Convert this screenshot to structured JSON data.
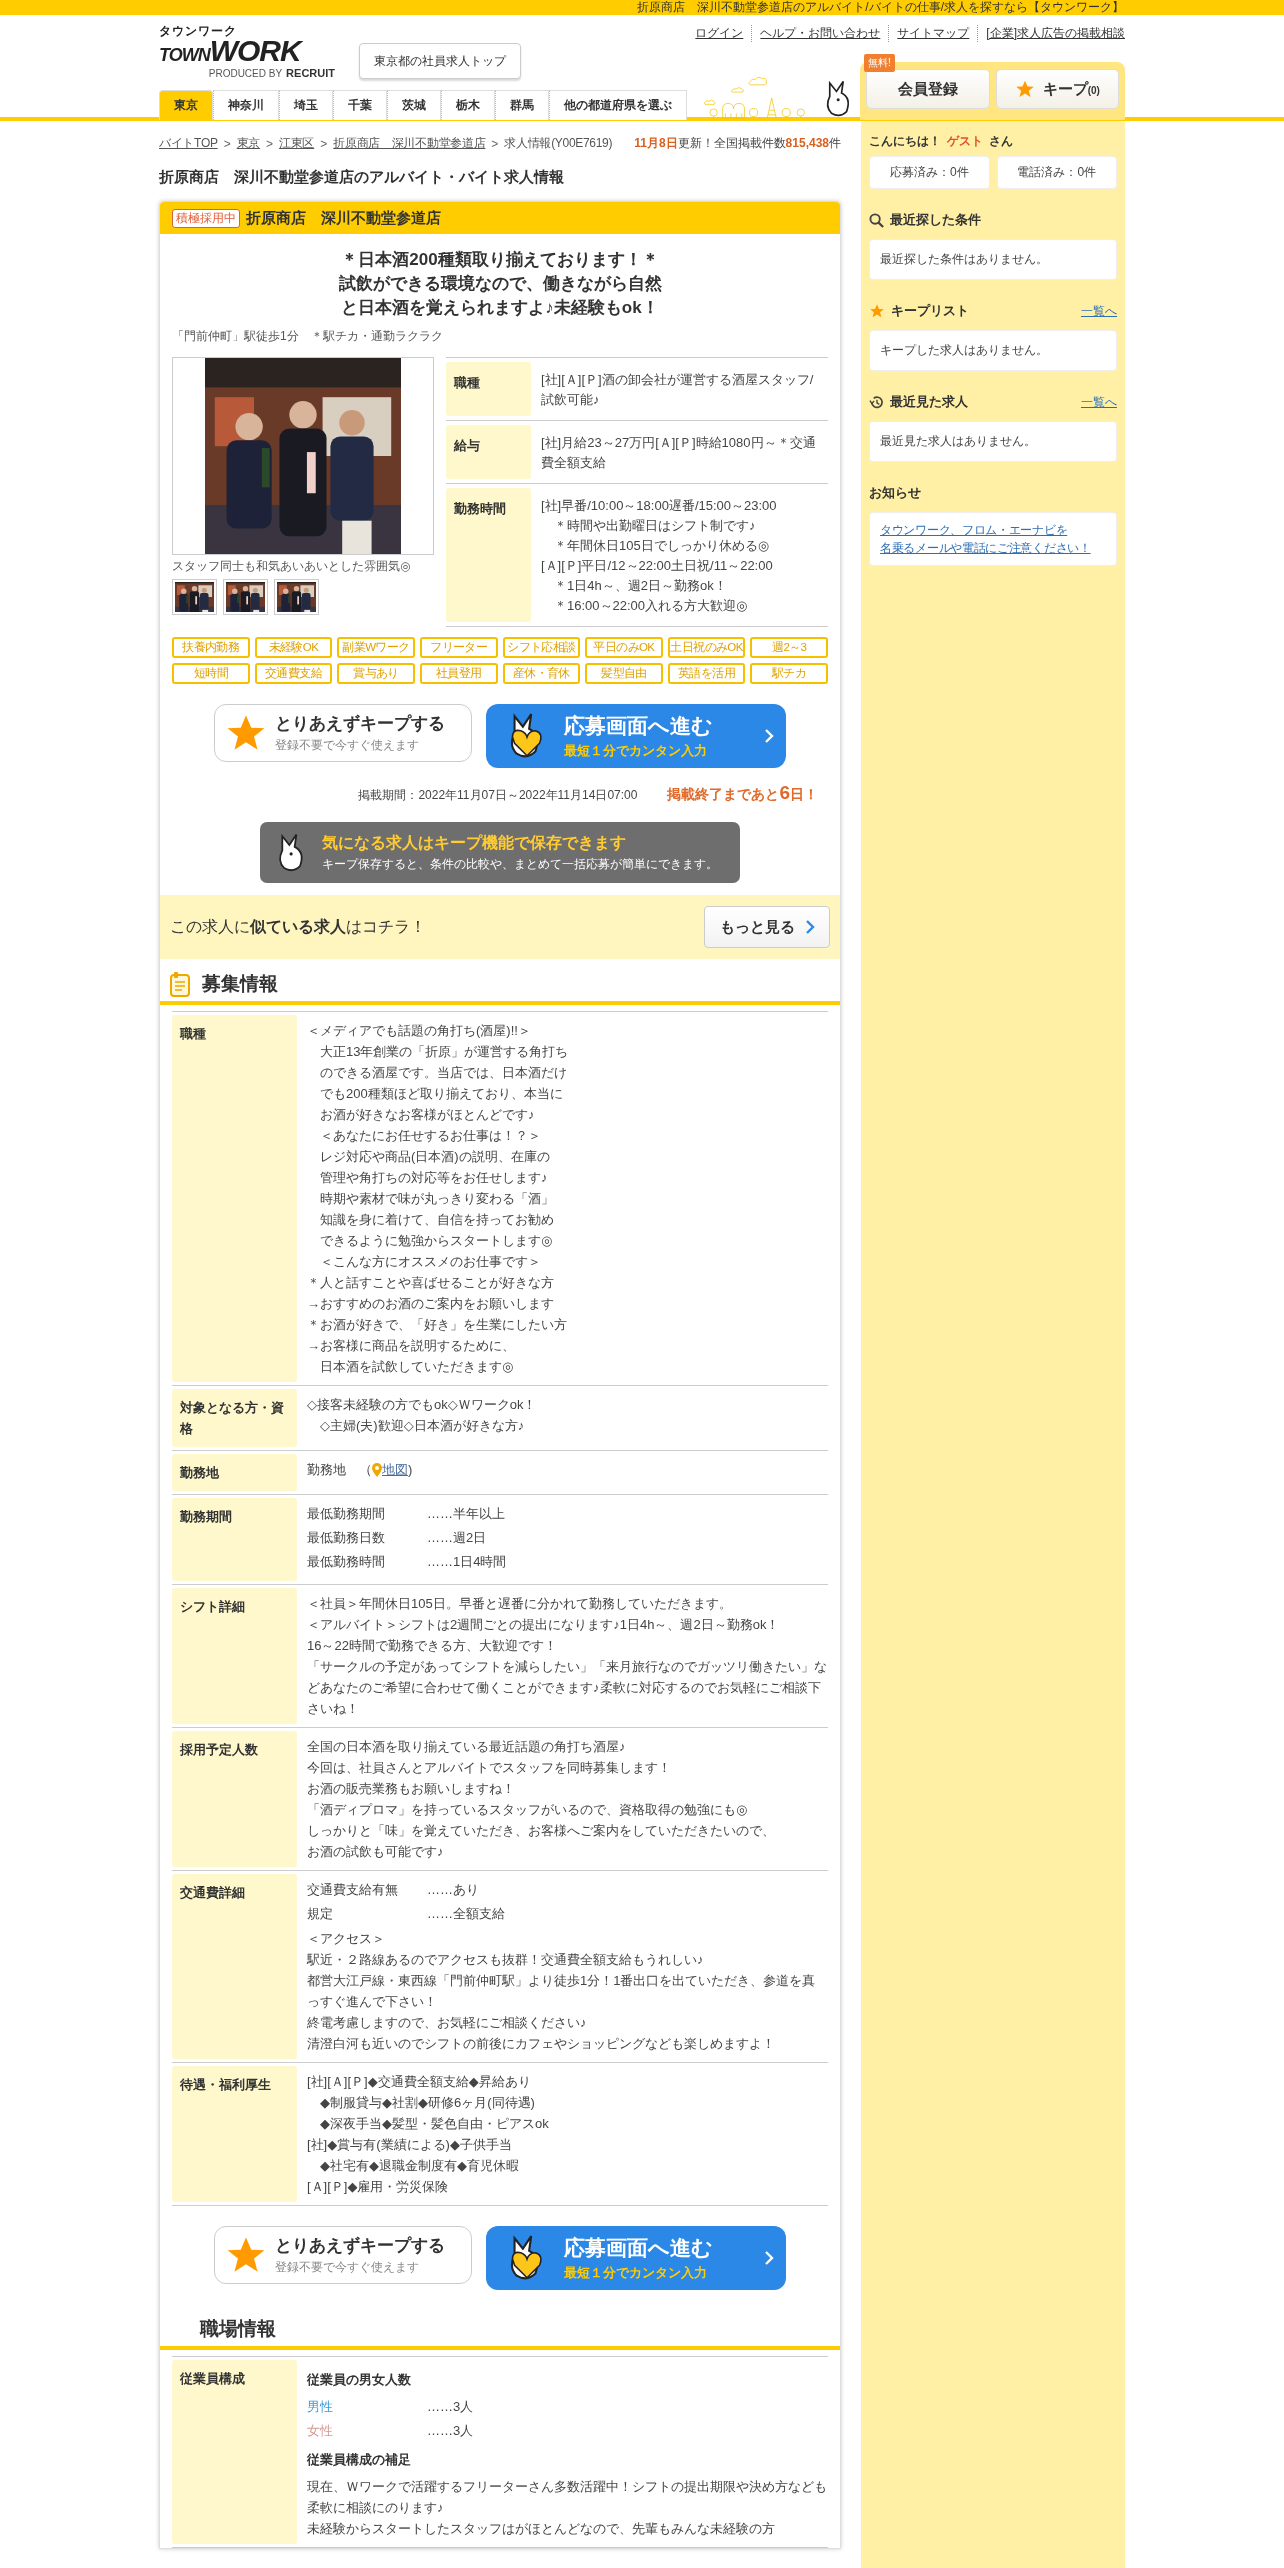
{
  "top_bar": {
    "text": "折原商店　深川不動堂参道店のアルバイト/バイトの仕事/求人を探すなら【タウンワーク】"
  },
  "header": {
    "logo": {
      "kana": "タウンワーク",
      "word_1": "TOWN",
      "word_2": "WORK",
      "credit": "PRODUCED BY",
      "brand": "RECRUIT"
    },
    "top_button": "東京都の社員求人トップ",
    "links": [
      "ログイン",
      "ヘルプ・お問い合わせ",
      "サイトマップ",
      "[企業]求人広告の掲載相談"
    ],
    "register": {
      "badge": "無料!",
      "label": "会員登録"
    },
    "keep": {
      "label": "キープ",
      "count": "(0)"
    },
    "prefecture_tabs": [
      {
        "label": "東京",
        "selected": true
      },
      {
        "label": "神奈川",
        "selected": false
      },
      {
        "label": "埼玉",
        "selected": false
      },
      {
        "label": "千葉",
        "selected": false
      },
      {
        "label": "茨城",
        "selected": false
      },
      {
        "label": "栃木",
        "selected": false
      },
      {
        "label": "群馬",
        "selected": false
      },
      {
        "label": "他の都道府県を選ぶ",
        "selected": false
      }
    ]
  },
  "breadcrumb": [
    {
      "label": "バイトTOP",
      "link": true
    },
    {
      "label": "東京",
      "link": true,
      "prefix": ">"
    },
    {
      "label": "江東区",
      "link": true,
      "prefix": ">"
    },
    {
      "label": "折原商店　深川不動堂参道店",
      "link": true,
      "prefix": ">"
    },
    {
      "label": "求人情報(Y00E7619)",
      "link": false,
      "prefix": ">"
    }
  ],
  "update": {
    "date": "11月8日",
    "text": "更新！全国掲載件数",
    "count": "815,438",
    "unit": "件"
  },
  "page_title": "折原商店　深川不動堂参道店のアルバイト・バイト求人情報",
  "job": {
    "badge": "積極採用中",
    "store": "折原商店　深川不動堂参道店",
    "catch": [
      "＊日本酒200種類取り揃えております！＊",
      "試飲ができる環境なので、働きながら自然",
      "と日本酒を覚えられますよ♪未経験もok！"
    ],
    "access": "「門前仲町」駅徒歩1分　＊駅チカ・通勤ラクラク",
    "photo": {
      "kind": "picture"
    },
    "photo_caption": "スタッフ同士も和気あいあいとした雰囲気◎",
    "thumbnails": [
      {
        "kind": "picture"
      },
      {
        "kind": "picture"
      },
      {
        "kind": "picture"
      }
    ],
    "summary": [
      {
        "label": "職種",
        "lines": [
          "[社][Ａ][Ｐ]酒の卸会社が運営する酒屋スタッフ/試飲可能♪"
        ]
      },
      {
        "label": "給与",
        "lines": [
          "[社]月給23～27万円[Ａ][Ｐ]時給1080円～＊交通費全額支給"
        ]
      },
      {
        "label": "勤務時間",
        "lines": [
          "[社]早番/10:00～18:00遅番/15:00～23:00",
          "　＊時間や出勤曜日はシフト制です♪",
          "　＊年間休日105日でしっかり休める◎",
          "[Ａ][Ｐ]平日/12～22:00土日祝/11～22:00",
          "　＊1日4h～、週2日～勤務ok！",
          "　＊16:00～22:00入れる方大歓迎◎"
        ]
      }
    ],
    "tags": [
      "扶養内勤務",
      "未経験OK",
      "副業Wワーク",
      "フリーター",
      "シフト応相談",
      "平日のみOK",
      "土日祝のみOK",
      "週2～3",
      "短時間",
      "交通費支給",
      "賞与あり",
      "社員登用",
      "産休・育休",
      "髪型自由",
      "英語を活用",
      "駅チカ"
    ]
  },
  "actions_top": {
    "keep_title": "とりあえずキープする",
    "keep_sub": "登録不要で今すぐ使えます",
    "apply_title": "応募画面へ進む",
    "apply_sub": "最短１分でカンタン入力"
  },
  "period": {
    "text": "掲載期間：2022年11月07日～2022年11月14日07:00",
    "before": "掲載終了まであと",
    "days": "6",
    "after": "日！"
  },
  "keep_banner": {
    "title": "気になる求人はキープ機能で保存できます",
    "text": "キープ保存すると、条件の比較や、まとめて一括応募が簡単にできます。"
  },
  "similar": {
    "text": "この求人に**似ている求人**はコチラ！",
    "button": "もっと見る"
  },
  "recruit_section": {
    "title": "募集情報",
    "rows": [
      {
        "label": "職種",
        "blocks": [
          {
            "kind": "lines",
            "lines": [
              "＜メディアでも話題の角打ち(酒屋)!!＞",
              "　大正13年創業の「折原」が運営する角打ち",
              "　のできる酒屋です。当店では、日本酒だけ",
              "　でも200種類ほど取り揃えており、本当に",
              "　お酒が好きなお客様がほとんどです♪",
              "　＜あなたにお任せするお仕事は！？＞",
              "　レジ対応や商品(日本酒)の説明、在庫の",
              "　管理や角打ちの対応等をお任せします♪",
              "　時期や素材で味が丸っきり変わる「酒」",
              "　知識を身に着けて、自信を持ってお勧め",
              "　できるように勉強からスタートします◎",
              "　＜こんな方にオススメのお仕事です＞",
              "＊人と話すことや喜ばせることが好きな方",
              "→おすすめのお酒のご案内をお願いします",
              "＊お酒が好きで、「好き」を生業にしたい方",
              "→お客様に商品を説明するために、",
              "　日本酒を試飲していただきます◎"
            ]
          }
        ]
      },
      {
        "label": "対象となる方・資格",
        "blocks": [
          {
            "kind": "lines",
            "lines": [
              "◇接客未経験の方でもok◇Ｗワークok！",
              "　◇主婦(夫)歓迎◇日本酒が好きな方♪"
            ]
          }
        ]
      },
      {
        "label": "勤務地",
        "blocks": [
          {
            "kind": "location",
            "before": "勤務地　（",
            "link": "地図",
            "after": ")"
          }
        ]
      },
      {
        "label": "勤務期間",
        "blocks": [
          {
            "kind": "pairs",
            "items": [
              {
                "label": "最低勤務期間",
                "value": "……半年以上"
              },
              {
                "label": "最低勤務日数",
                "value": "……週2日"
              },
              {
                "label": "最低勤務時間",
                "value": "……1日4時間"
              }
            ]
          }
        ]
      },
      {
        "label": "シフト詳細",
        "blocks": [
          {
            "kind": "lines",
            "lines": [
              "＜社員＞年間休日105日。早番と遅番に分かれて勤務していただきます。",
              "＜アルバイト＞シフトは2週間ごとの提出になります♪1日4h～、週2日～勤務ok！",
              "16～22時間で勤務できる方、大歓迎です！",
              "「サークルの予定があってシフトを減らしたい」「来月旅行なのでガッツリ働きたい」などあなたのご希望に合わせて働くことができます♪柔軟に対応するのでお気軽にご相談下さいね！"
            ]
          }
        ]
      },
      {
        "label": "採用予定人数",
        "blocks": [
          {
            "kind": "lines",
            "lines": [
              "全国の日本酒を取り揃えている最近話題の角打ち酒屋♪",
              "今回は、社員さんとアルバイトでスタッフを同時募集します！",
              "お酒の販売業務もお願いしますね！",
              "「酒ディプロマ」を持っているスタッフがいるので、資格取得の勉強にも◎",
              "しっかりと「味」を覚えていただき、お客様へご案内をしていただきたいので、",
              "お酒の試飲も可能です♪"
            ]
          }
        ]
      },
      {
        "label": "交通費詳細",
        "blocks": [
          {
            "kind": "pairs",
            "items": [
              {
                "label": "交通費支給有無",
                "value": "……あり"
              },
              {
                "label": "規定",
                "value": "……全額支給"
              }
            ]
          },
          {
            "kind": "lines",
            "lines": [
              "＜アクセス＞",
              "駅近・２路線あるのでアクセスも抜群！交通費全額支給もうれしい♪",
              "都営大江戸線・東西線「門前仲町駅」より徒歩1分！1番出口を出ていただき、参道を真っすぐ進んで下さい！",
              "終電考慮しますので、お気軽にご相談ください♪",
              "清澄白河も近いのでシフトの前後にカフェやショッピングなども楽しめますよ！"
            ]
          }
        ]
      },
      {
        "label": "待遇・福利厚生",
        "blocks": [
          {
            "kind": "lines",
            "lines": [
              "[社][Ａ][Ｐ]◆交通費全額支給◆昇給あり",
              "　◆制服貸与◆社割◆研修6ヶ月(同待遇)",
              "　◆深夜手当◆髪型・髪色自由・ピアスok",
              "[社]◆賞与有(業績による)◆子供手当",
              "　◆社宅有◆退職金制度有◆育児休暇",
              "[Ａ][Ｐ]◆雇用・労災保険"
            ]
          }
        ]
      }
    ]
  },
  "actions_bottom": {
    "keep_title": "とりあえずキープする",
    "keep_sub": "登録不要で今すぐ使えます",
    "apply_title": "応募画面へ進む",
    "apply_sub": "最短１分でカンタン入力"
  },
  "workplace_section": {
    "title": "職場情報",
    "rows": [
      {
        "label": "従業員構成",
        "blocks": [
          {
            "kind": "heading",
            "text": "従業員の男女人数"
          },
          {
            "kind": "pairs",
            "items": [
              {
                "label": "男性",
                "value": "……3人",
                "color": "#3a9ad9"
              },
              {
                "label": "女性",
                "value": "……3人",
                "color": "#d49a94"
              }
            ]
          },
          {
            "kind": "heading",
            "text": "従業員構成の補足"
          },
          {
            "kind": "lines",
            "lines": [
              "現在、Ｗワークで活躍するフリーターさん多数活躍中！シフトの提出期限や決め方なども柔軟に相談にのります♪",
              "未経験からスタートしたスタッフはがほとんどなので、先輩もみんな未経験の方"
            ]
          }
        ]
      }
    ]
  },
  "sidebar": {
    "greeting": {
      "hello": "こんにちは！",
      "name": "ゲスト",
      "suffix": "さん"
    },
    "counters": [
      "応募済み：0件",
      "電話済み：0件"
    ],
    "panels": [
      {
        "kind": "search",
        "title": "最近探した条件",
        "empty": "最近探した条件はありません。"
      },
      {
        "kind": "keep",
        "title": "キープリスト",
        "link": "一覧へ",
        "empty": "キープした求人はありません。"
      },
      {
        "kind": "history",
        "title": "最近見た求人",
        "link": "一覧へ",
        "empty": "最近見た求人はありません。"
      }
    ],
    "notice": {
      "title": "お知らせ",
      "lines": [
        "タウンワーク、フロム・エーナビを",
        "名乗るメールや電話にご注意ください！"
      ]
    }
  }
}
